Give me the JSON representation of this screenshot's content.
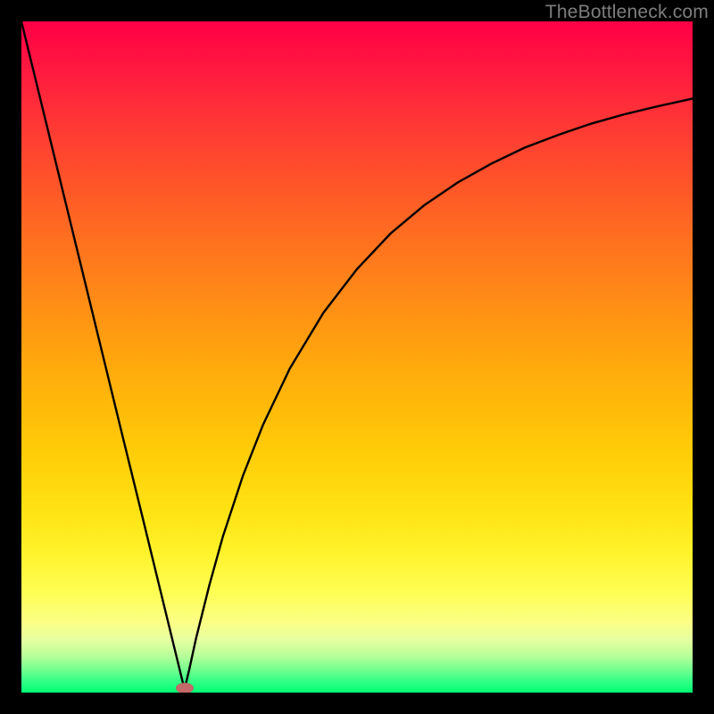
{
  "watermark": {
    "text": "TheBottleneck.com"
  },
  "chart_data": {
    "type": "line",
    "title": "",
    "xlabel": "",
    "ylabel": "",
    "xlim": [
      0,
      100
    ],
    "ylim": [
      0,
      100
    ],
    "grid": false,
    "background": "red-yellow-green vertical gradient",
    "marker": {
      "x": 24.3,
      "y": 0.7,
      "color": "#c46a6a"
    },
    "series": [
      {
        "name": "curve",
        "x": [
          0,
          5,
          10,
          15,
          18,
          20,
          22,
          23,
          24,
          24.3,
          25,
          26,
          28,
          30,
          33,
          36,
          40,
          45,
          50,
          55,
          60,
          65,
          70,
          75,
          80,
          85,
          90,
          95,
          100
        ],
        "values": [
          100,
          79.5,
          59.0,
          38.5,
          26.3,
          18.1,
          9.9,
          5.8,
          1.7,
          0.5,
          3.4,
          8.0,
          16.0,
          23.2,
          32.3,
          39.9,
          48.3,
          56.6,
          63.1,
          68.4,
          72.6,
          76.0,
          78.8,
          81.2,
          83.1,
          84.8,
          86.2,
          87.4,
          88.5
        ]
      }
    ]
  }
}
